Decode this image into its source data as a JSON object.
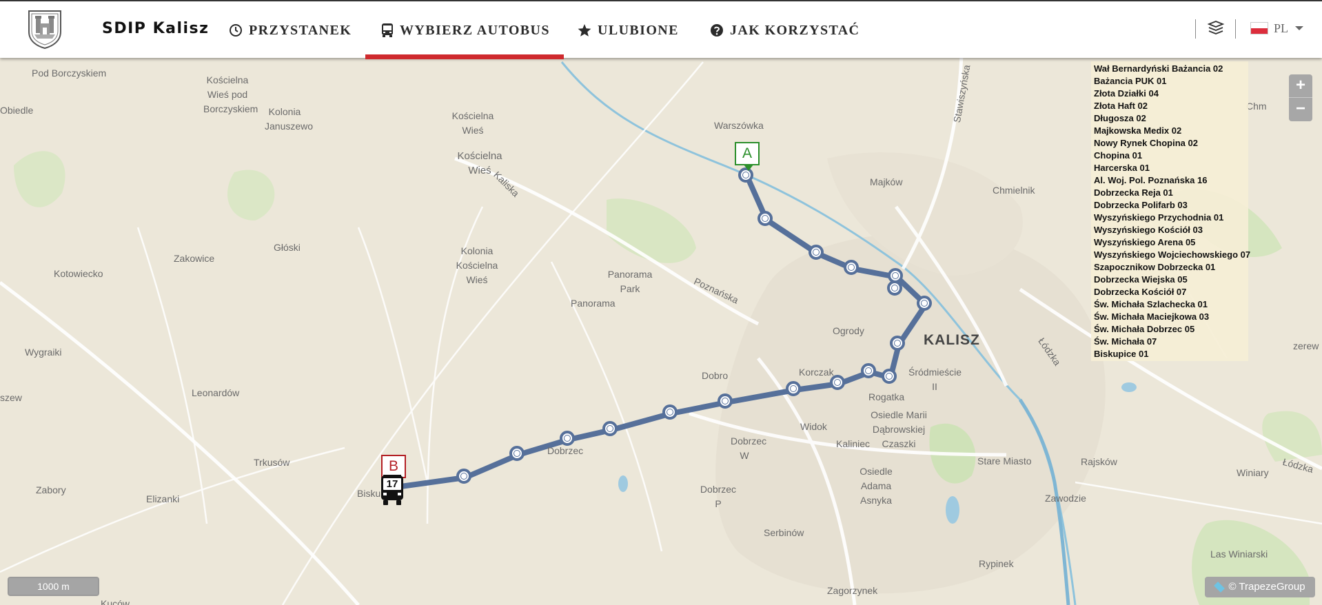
{
  "header": {
    "app_name": "SDIP Kalisz",
    "nav": [
      {
        "label": "PRZYSTANEK",
        "icon": "clock-icon"
      },
      {
        "label": "WYBIERZ AUTOBUS",
        "icon": "bus-icon",
        "active": true
      },
      {
        "label": "ULUBIONE",
        "icon": "star-icon"
      },
      {
        "label": "JAK KORZYSTAĆ",
        "icon": "question-icon"
      }
    ],
    "language": "PL",
    "accent_color": "#cf2a2e"
  },
  "map": {
    "labels": [
      "Pod Borczyskiem",
      "Kościelna Wieś pod Borczyskiem",
      "Kolonia Januszewo",
      "Kościelna Wieś",
      "Kościelna Wieś",
      "Kaliska",
      "Obiedle",
      "Zakowice",
      "Głóski",
      "Kotowiecko",
      "Kolonia Kościelna Wieś",
      "Panorama Park",
      "Panorama",
      "Poznańska",
      "Wygraiki",
      "Leonardów",
      "szew",
      "Trkusów",
      "Zabory",
      "Elizanki",
      "Bisku",
      "Dobrzec",
      "Dobrzec W",
      "Dobrzec P",
      "Dobro",
      "Korczak",
      "Widok",
      "Kaliniec",
      "Osiedle Marii Dąbrowskiej Czaszki",
      "Osiedle Adama Asnyka",
      "Serbinów",
      "Zagorzynek",
      "Kuców",
      "Warszówka",
      "Majków",
      "Chmielnik",
      "Stawiszyńska",
      "Ogrody",
      "KALISZ",
      "Śródmieście II",
      "Rogatka",
      "Stare Miasto",
      "Zawodzie",
      "Rypinek",
      "Rajsków",
      "Łódzka",
      "Łódzka",
      "Winiary",
      "Las Winiarski",
      "Chm",
      "zerew"
    ],
    "route_number": "17",
    "route_color": "#56709a",
    "start_marker": "A",
    "end_marker": "B"
  },
  "stop_list": [
    "Wał Bernardyński Bażancia 02",
    "Bażancia PUK 01",
    "Złota Działki 04",
    "Złota Haft 02",
    "Długosza 02",
    "Majkowska Medix 02",
    "Nowy Rynek Chopina 02",
    "Chopina 01",
    "Harcerska 01",
    "Al. Woj. Pol. Poznańska 16",
    "Dobrzecka Reja 01",
    "Dobrzecka Polifarb 03",
    "Wyszyńskiego Przychodnia 01",
    "Wyszyńskiego Kościół 03",
    "Wyszyńskiego Arena 05",
    "Wyszyńskiego Wojciechowskiego 07",
    "Szapocznikow Dobrzecka 01",
    "Dobrzecka Wiejska 05",
    "Dobrzecka Kościół 07",
    "Św. Michała Szlachecka 01",
    "Św. Michała Maciejkowa 03",
    "Św. Michała Dobrzec 05",
    "Św. Michała 07",
    "Biskupice 01"
  ],
  "controls": {
    "zoom_in": "+",
    "zoom_out": "−",
    "scale": "1000 m",
    "attribution": "© TrapezeGroup"
  }
}
